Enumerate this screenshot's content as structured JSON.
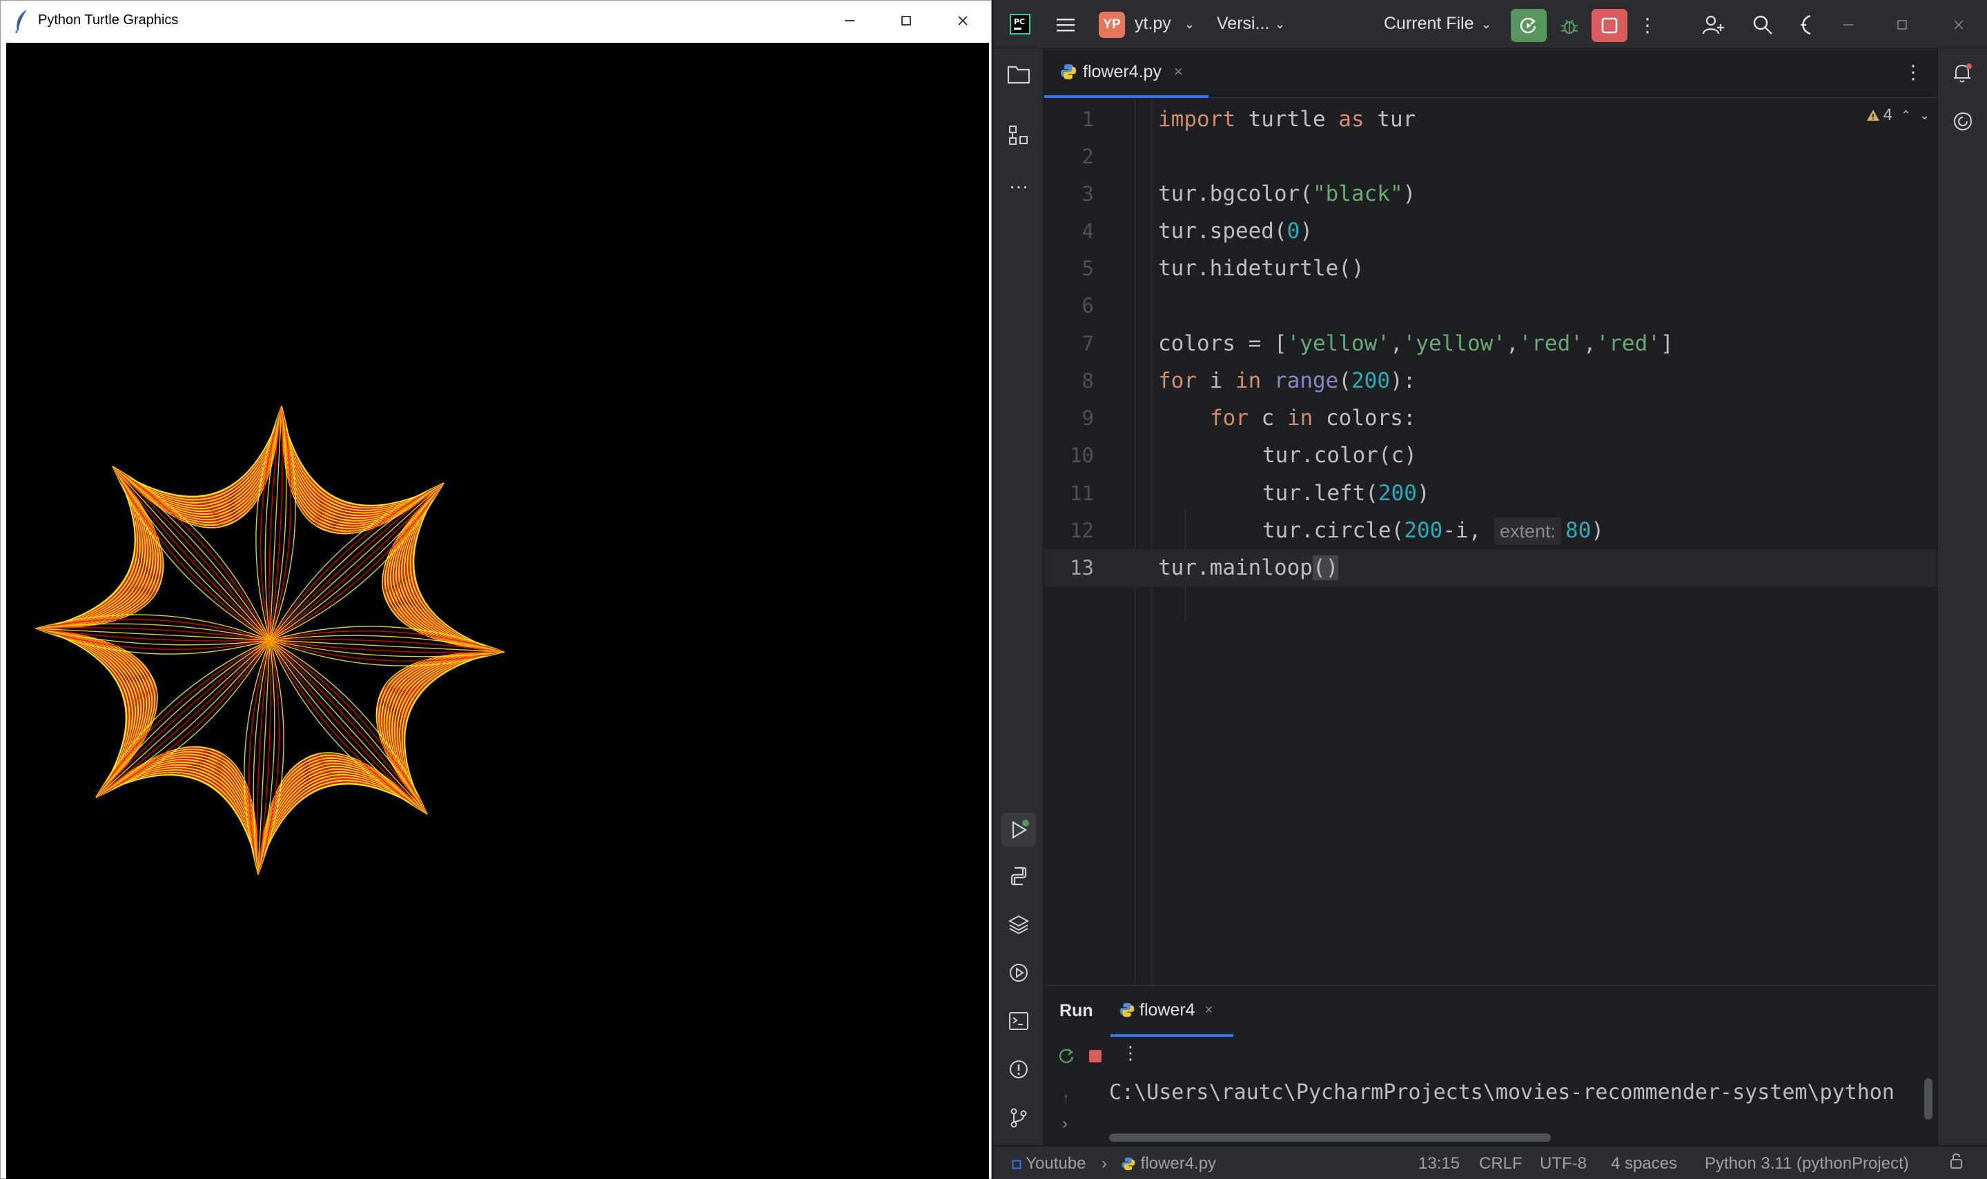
{
  "turtle_window": {
    "title": "Python Turtle Graphics",
    "controls": [
      "—",
      "☐",
      "✕"
    ],
    "canvas_bg": "#000000",
    "drawing": {
      "shape": "8-pointed star",
      "points": 8,
      "colors": [
        "#ffff00",
        "#ff0000"
      ]
    }
  },
  "ide": {
    "titlebar": {
      "project_badge": "YP",
      "project_name": "yt.py",
      "vcs": "Versi...",
      "run_config": "Current File"
    },
    "editor_tab": {
      "label": "flower4.py",
      "close": "×"
    },
    "inspection": {
      "warnings": "4"
    },
    "code_lines": [
      {
        "n": "1"
      },
      {
        "n": "2"
      },
      {
        "n": "3"
      },
      {
        "n": "4"
      },
      {
        "n": "5"
      },
      {
        "n": "6"
      },
      {
        "n": "7"
      },
      {
        "n": "8"
      },
      {
        "n": "9"
      },
      {
        "n": "10"
      },
      {
        "n": "11"
      },
      {
        "n": "12"
      },
      {
        "n": "13"
      }
    ],
    "code_tokens": {
      "l1_import": "import",
      "l1_turtle": " turtle ",
      "l1_as": "as",
      "l1_tur": " tur",
      "l3_a": "tur.bgcolor(",
      "l3_s": "\"black\"",
      "l3_b": ")",
      "l4_a": "tur.speed(",
      "l4_n": "0",
      "l4_b": ")",
      "l5": "tur.hideturtle()",
      "l7_a": "colors = [",
      "l7_s1": "'yellow'",
      "l7_c1": ",",
      "l7_s2": "'yellow'",
      "l7_c2": ",",
      "l7_s3": "'red'",
      "l7_c3": ",",
      "l7_s4": "'red'",
      "l7_b": "]",
      "l8_for": "for",
      "l8_i": " i ",
      "l8_in": "in",
      "l8_sp": " ",
      "l8_range": "range",
      "l8_p": "(",
      "l8_n": "200",
      "l8_b": "):",
      "l9_for": "for",
      "l9_c": " c ",
      "l9_in": "in",
      "l9_b": " colors:",
      "l10": "tur.color(c)",
      "l11_a": "tur.left(",
      "l11_n": "200",
      "l11_b": ")",
      "l12_a": "tur.circle(",
      "l12_n": "200",
      "l12_m": "-i, ",
      "l12_hint": "extent:",
      "l12_n2": "80",
      "l12_b": ")",
      "l13_a": "tur.mainloop",
      "l13_b": "()"
    },
    "run_panel": {
      "title": "Run",
      "tab_label": "flower4",
      "tab_close": "×",
      "console_line": "C:\\Users\\rautc\\PycharmProjects\\movies-recommender-system\\python"
    },
    "status_bar": {
      "breadcrumb_project": "Youtube",
      "breadcrumb_file": "flower4.py",
      "position": "13:15",
      "line_sep": "CRLF",
      "encoding": "UTF-8",
      "indent": "4 spaces",
      "interpreter": "Python 3.11 (pythonProject)"
    },
    "colors": {
      "accent": "#3574f0",
      "run_green": "#57965c",
      "stop_red": "#db5c5c",
      "keyword": "#cf8e6d",
      "string": "#6aab73",
      "number": "#2aacb8",
      "builtin": "#8888c6"
    },
    "left_toolbar_icons": [
      "folder-icon",
      "structure-icon",
      "more-icon",
      "run-tool-icon",
      "python-console-icon",
      "layers-icon",
      "services-icon",
      "terminal-icon",
      "problems-icon",
      "git-icon"
    ],
    "right_toolbar_icons": [
      "notifications-icon",
      "ai-assistant-icon"
    ]
  }
}
